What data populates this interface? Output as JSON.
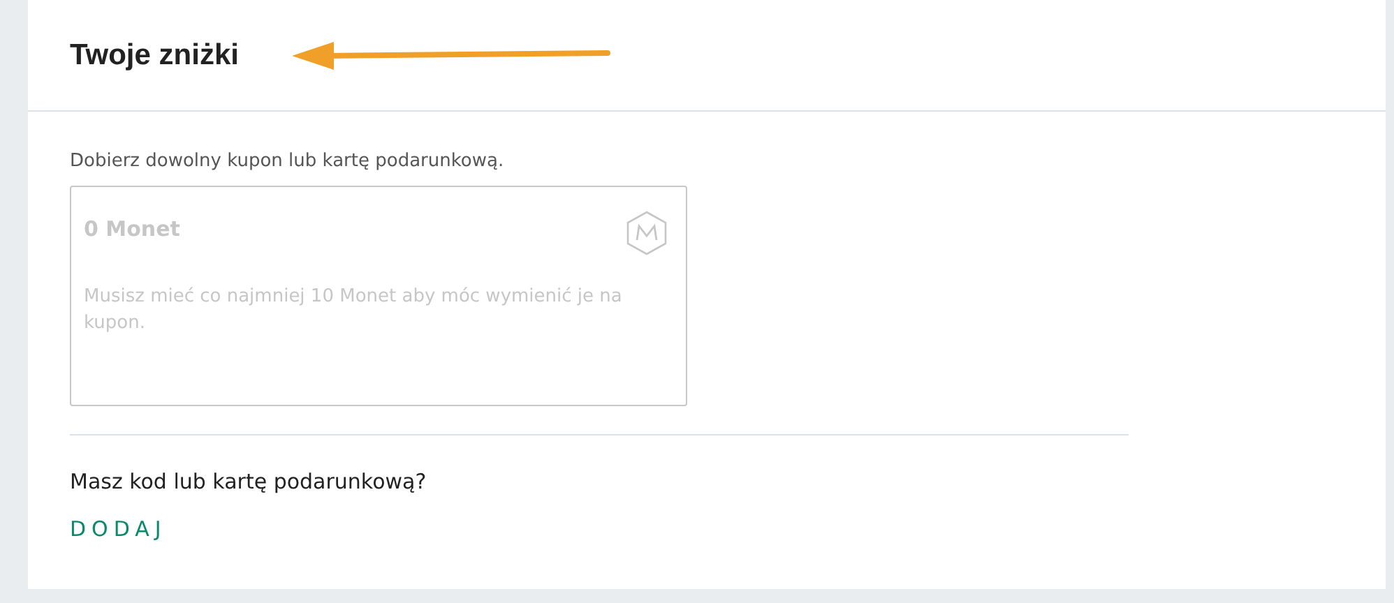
{
  "header": {
    "title": "Twoje zniżki"
  },
  "intro": "Dobierz dowolny kupon lub kartę podarunkową.",
  "coin_card": {
    "title": "0 Monet",
    "message": "Musisz mieć co najmniej 10 Monet aby móc wymienić je na kupon.",
    "disabled": true
  },
  "redeem": {
    "question": "Masz kod lub kartę podarunkową?",
    "action": "DODAJ"
  }
}
